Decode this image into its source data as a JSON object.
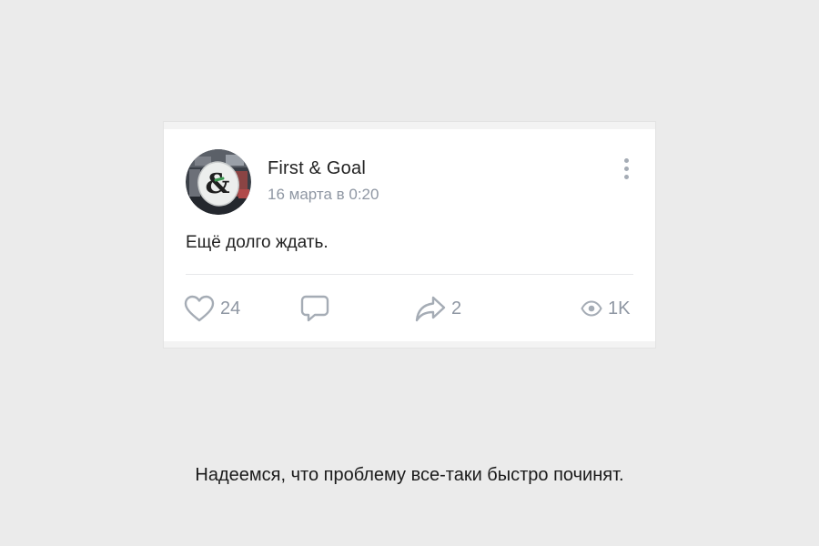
{
  "post": {
    "author_name": "First & Goal",
    "timestamp": "16 марта в 0:20",
    "text": "Ещё долго ждать.",
    "likes_count": "24",
    "reposts_count": "2",
    "views_count": "1K",
    "icons": {
      "like": "heart-icon",
      "comment": "comment-icon",
      "share": "share-icon",
      "views": "eye-icon",
      "more": "more-vertical-icon"
    },
    "avatar_glyph": "&"
  },
  "caption": "Надеемся, что проблему все-таки быстро починят.",
  "colors": {
    "page_background": "#ebebeb",
    "card_background": "#ffffff",
    "secondary_text": "#8f97a3",
    "icon_gray": "#a5acb5"
  }
}
